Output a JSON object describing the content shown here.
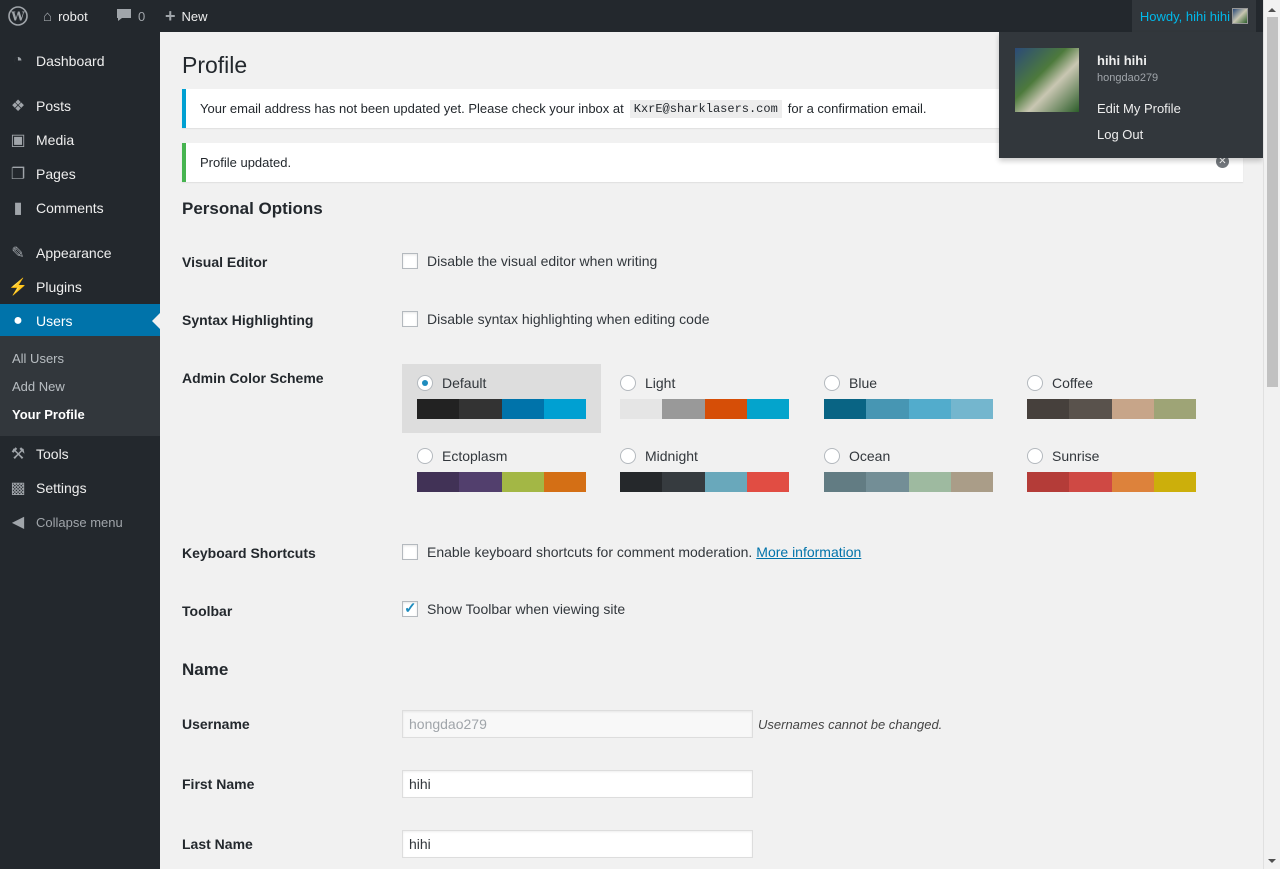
{
  "adminbar": {
    "site_name": "robot",
    "comments_count": "0",
    "new_label": "New",
    "howdy": "Howdy, hihi hihi"
  },
  "sidebar": {
    "items": [
      {
        "label": "Dashboard",
        "icon": "dashboard-icon"
      },
      {
        "label": "Posts",
        "icon": "pin-icon"
      },
      {
        "label": "Media",
        "icon": "media-icon"
      },
      {
        "label": "Pages",
        "icon": "pages-icon"
      },
      {
        "label": "Comments",
        "icon": "comment-icon"
      },
      {
        "label": "Appearance",
        "icon": "brush-icon"
      },
      {
        "label": "Plugins",
        "icon": "plug-icon"
      },
      {
        "label": "Users",
        "icon": "user-icon"
      },
      {
        "label": "Tools",
        "icon": "wrench-icon"
      },
      {
        "label": "Settings",
        "icon": "settings-icon"
      }
    ],
    "submenu": [
      "All Users",
      "Add New",
      "Your Profile"
    ],
    "collapse": "Collapse menu"
  },
  "page": {
    "title": "Profile",
    "notice_email_before": "Your email address has not been updated yet. Please check your inbox at",
    "notice_email_code": "KxrE@sharklasers.com",
    "notice_email_after": "for a confirmation email.",
    "notice_updated": "Profile updated."
  },
  "personal": {
    "heading": "Personal Options",
    "visual_editor_label": "Visual Editor",
    "visual_editor_text": "Disable the visual editor when writing",
    "syntax_label": "Syntax Highlighting",
    "syntax_text": "Disable syntax highlighting when editing code",
    "scheme_label": "Admin Color Scheme",
    "schemes": [
      {
        "name": "Default",
        "colors": [
          "#222222",
          "#333333",
          "#0073aa",
          "#00a0d2"
        ]
      },
      {
        "name": "Light",
        "colors": [
          "#e5e5e5",
          "#999999",
          "#d64e07",
          "#04a4cc"
        ]
      },
      {
        "name": "Blue",
        "colors": [
          "#096484",
          "#4796b3",
          "#52accc",
          "#74b6ce"
        ]
      },
      {
        "name": "Coffee",
        "colors": [
          "#46403c",
          "#59524c",
          "#c7a589",
          "#9ea476"
        ]
      },
      {
        "name": "Ectoplasm",
        "colors": [
          "#413256",
          "#523f6d",
          "#a3b745",
          "#d46f15"
        ]
      },
      {
        "name": "Midnight",
        "colors": [
          "#25282b",
          "#363b3f",
          "#69a8bb",
          "#e14d43"
        ]
      },
      {
        "name": "Ocean",
        "colors": [
          "#627c83",
          "#738e96",
          "#9ebaa0",
          "#aa9d88"
        ]
      },
      {
        "name": "Sunrise",
        "colors": [
          "#b43c38",
          "#cf4944",
          "#dd823b",
          "#ccaf0b"
        ]
      }
    ],
    "keyboard_label": "Keyboard Shortcuts",
    "keyboard_text": "Enable keyboard shortcuts for comment moderation.",
    "keyboard_link": "More information",
    "toolbar_label": "Toolbar",
    "toolbar_text": "Show Toolbar when viewing site"
  },
  "name": {
    "heading": "Name",
    "username_label": "Username",
    "username_value": "hongdao279",
    "username_desc": "Usernames cannot be changed.",
    "first_label": "First Name",
    "first_value": "hihi",
    "last_label": "Last Name",
    "last_value": "hihi"
  },
  "dropdown": {
    "display_name": "hihi hihi",
    "username": "hongdao279",
    "edit_profile": "Edit My Profile",
    "log_out": "Log Out"
  }
}
